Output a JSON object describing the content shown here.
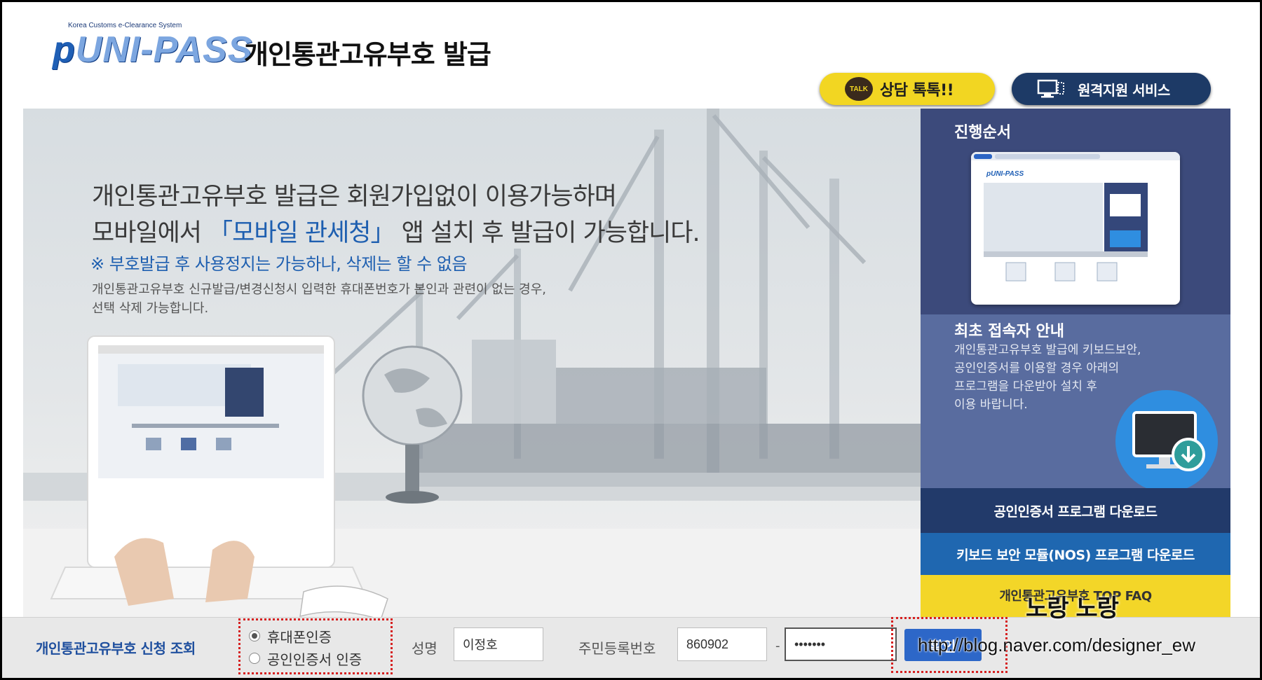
{
  "header": {
    "logo_small": "Korea Customs e-Clearance System",
    "logo_main": "UNI-PASS",
    "title": "개인통관고유부호 발급",
    "talk_icon": "TALK",
    "talk_label": "상담 톡톡!!",
    "remote_label": "원격지원 서비스"
  },
  "hero": {
    "line1": "개인통관고유부호 발급은 회원가입없이 이용가능하며",
    "line2_pre": "모바일에서 ",
    "line2_highlight": "「모바일 관세청」",
    "line2_post": " 앱 설치 후 발급이 가능합니다.",
    "note": "※ 부호발급 후 사용정지는 가능하나, 삭제는 할 수 없음",
    "desc1": "개인통관고유부호 신규발급/변경신청시 입력한 휴대폰번호가 본인과 관련이 없는 경우,",
    "desc2": "선택 삭제 가능합니다."
  },
  "side": {
    "steps_title": "진행순서",
    "first_title": "최초 접속자 안내",
    "first_desc": [
      "개인통관고유부호 발급에 키보드보안,",
      "공인인증서를 이용할 경우 아래의",
      "프로그램을 다운받아 설치 후",
      "이용 바랍니다."
    ],
    "btn_cert": "공인인증서 프로그램 다운로드",
    "btn_nos": "키보드 보안 모듈(NOS) 프로그램 다운로드",
    "btn_faq": "개인통관고유부호 TOP FAQ"
  },
  "bottom": {
    "title": "개인통관고유부호 신청 조회",
    "radio_phone": "휴대폰인증",
    "radio_cert": "공인인증서 인증",
    "name_label": "성명",
    "name_value": "이정호",
    "rrn_label": "주민등록번호",
    "rrn_front": "860902",
    "rrn_dash": "-",
    "rrn_back": "•••••••",
    "ok_label": "확인"
  },
  "watermark": {
    "url": "http://blog.naver.com/designer_ew",
    "name": "노랑 노랑"
  },
  "colors": {
    "brand_blue": "#1f5fb5",
    "talk_yellow": "#f2d622",
    "remote_navy": "#1d3a66",
    "panel_navy": "#3c4a7b",
    "highlight_red": "#d62020"
  }
}
